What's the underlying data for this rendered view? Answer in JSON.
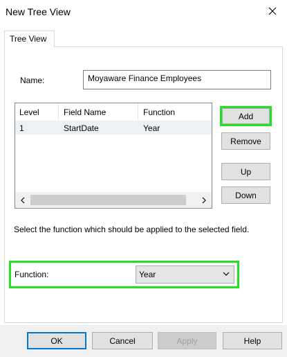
{
  "window": {
    "title": "New Tree View"
  },
  "tabs": [
    {
      "label": "Tree View"
    }
  ],
  "name": {
    "label": "Name:",
    "value": "Moyaware Finance Employees"
  },
  "list": {
    "columns": [
      "Level",
      "Field Name",
      "Function"
    ],
    "rows": [
      {
        "level": "1",
        "field": "StartDate",
        "function": "Year"
      }
    ]
  },
  "side_buttons": {
    "add": "Add",
    "remove": "Remove",
    "up": "Up",
    "down": "Down"
  },
  "hint": "Select the function which should be applied to the selected field.",
  "function": {
    "label": "Function:",
    "selected": "Year"
  },
  "footer": {
    "ok": "OK",
    "cancel": "Cancel",
    "apply": "Apply",
    "help": "Help"
  },
  "colors": {
    "highlight": "#22e022",
    "default_button_border": "#0078d7"
  }
}
